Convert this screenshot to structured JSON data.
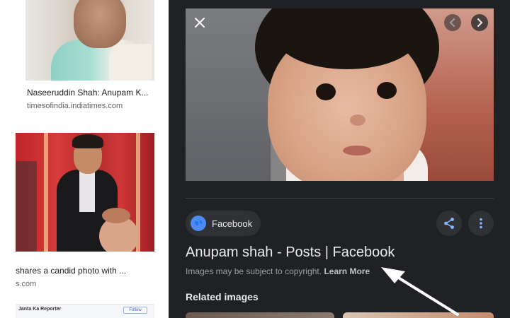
{
  "results": [
    {
      "title": "Naseeruddin Shah: Anupam K...",
      "source": "timesofindia.indiatimes.com"
    },
    {
      "title": "shares a candid photo with ...",
      "source": "s.com"
    },
    {
      "thumb_text": "Janta Ka Reporter",
      "thumb_button": "Follow"
    }
  ],
  "panel": {
    "close_icon": "close-icon",
    "prev_icon": "chevron-left-icon",
    "next_icon": "chevron-right-icon",
    "source_chip": {
      "label": "Facebook",
      "icon": "globe-icon"
    },
    "share_icon": "share-icon",
    "more_icon": "more-vert-icon",
    "title": "Anupam shah - Posts | Facebook",
    "copyright_text": "Images may be subject to copyright.",
    "learn_more": "Learn More",
    "related_heading": "Related images"
  },
  "colors": {
    "panel_bg": "#202124",
    "chip_bg": "#303134",
    "accent_blue": "#8ab4f8",
    "annotation_arrow": "#ffffff"
  }
}
